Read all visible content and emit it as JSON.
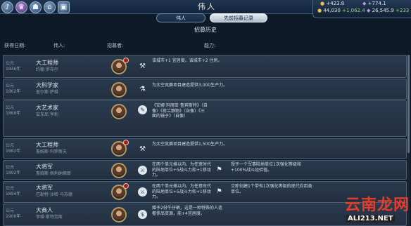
{
  "header": {
    "title": "伟人",
    "hud_icons": [
      "culture-icon",
      "government-icon",
      "religion-icon",
      "city-icon",
      "greatworks-icon"
    ]
  },
  "resources": {
    "gold_rate": "+423.8",
    "gold": "44,030",
    "gold_extra": "+1,062.4",
    "faith_rate": "+774.1",
    "faith": "26,545.9",
    "faith_extra": "+233"
  },
  "tabs": [
    {
      "label": "伟人",
      "active": false
    },
    {
      "label": "先前招募记录",
      "active": true
    }
  ],
  "subtitle": "招募历史",
  "columns": {
    "date": "获得日期:",
    "person": "伟人:",
    "recruiter": "招募者:",
    "effect": "能力:"
  },
  "rows": [
    {
      "date": "公元1846年",
      "name": "大工程师",
      "sub": "约翰·罗布尔",
      "icon": "hammer-icon",
      "desc": "该城市+1 宜居度。该城市+2 住房。"
    },
    {
      "date": "公元1862年",
      "name": "大科学家",
      "sub": "查尔斯·萨维",
      "icon": "science-icon",
      "desc": "为太空竞赛项目建造提供3,000生产力。"
    },
    {
      "date": "公元1869年",
      "name": "大艺术家",
      "sub": "安东尼·亨利",
      "icon": "palette-icon",
      "desc": "《安娜·玛丽亚·鲁宾斯特》（自像）《荷兰静物》（自像）《三面的镜子》（自像）"
    },
    {
      "date": "公元1882年",
      "name": "大工程师",
      "sub": "詹姆斯·玛罗斯夫",
      "icon": "hammer-icon",
      "desc": "为太空竞赛项目建造提供1,500生产力。"
    },
    {
      "date": "公元1892年",
      "name": "大将军",
      "sub": "詹姆斯·佩利纳佛耶",
      "icon": "sword-icon",
      "desc": "在两个单元格以内，为任意时代的陆地单位+5战斗力和+1移动力。",
      "icon2": "flag-icon",
      "desc2": "授予一个军事陆地单位1次强化等级和+100%战斗经验值。"
    },
    {
      "date": "公元1894年",
      "name": "大将军",
      "sub": "巴勒特·沙哈·马苏德",
      "icon": "sword-icon",
      "desc": "在两个单元格以内，为任意时代的陆地单位+5战斗力和+1移动力。",
      "icon2": "flag-icon",
      "desc2": "立即创建1个带有1次强化等级的现代应用类单位。"
    },
    {
      "date": "公元1900年",
      "name": "大商人",
      "sub": "李维·斯特劳斯",
      "icon": "coin-icon",
      "desc": "赠予2份牛仔裤，这是一种特殊的人造奢侈品资源，能+4宜居度。"
    }
  ],
  "watermark": {
    "cn": "云南龙网",
    "en": "ALI213.NET"
  }
}
